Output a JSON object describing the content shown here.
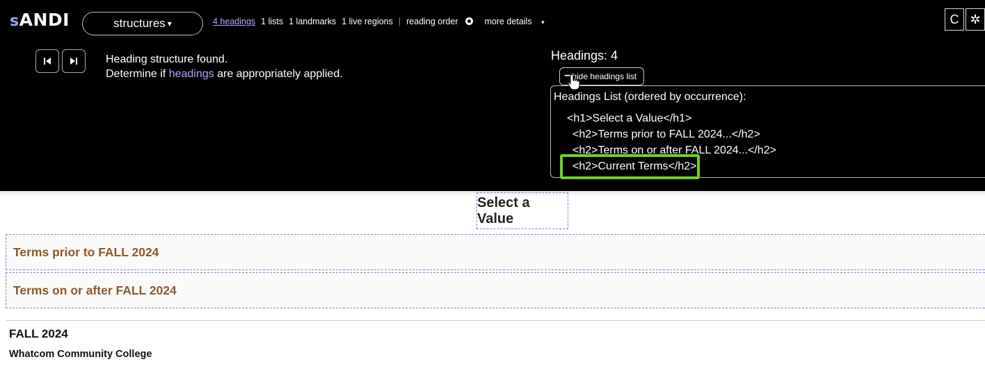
{
  "andi": {
    "logo_prefix": "s",
    "logo_main": "ANDI",
    "module": "structures",
    "caret": "▾",
    "summary": {
      "headings": "4 headings",
      "lists": "1 lists",
      "landmarks": "1 landmarks",
      "live_regions": "1 live regions",
      "separator": "|",
      "reading_order": "reading order",
      "more_details": "more details"
    },
    "refresh_icon": "C",
    "settings_icon": "✲",
    "output_line1": "Heading structure found.",
    "output_line2_pre": "Determine if ",
    "output_line2_link": "headings",
    "output_line2_post": " are appropriately applied.",
    "headings_count": "Headings: 4",
    "hide_list_label": "hide headings list",
    "hide_list_symbol": "−",
    "panel_title": "Headings List (ordered by occurrence):",
    "headings_list": [
      "<h1>Select a Value</h1>",
      "<h2>Terms prior to FALL 2024...</h2>",
      "<h2>Terms on or after FALL 2024...</h2>",
      "<h2>Current Terms</h2>"
    ],
    "highlight_color": "#6fcf2c",
    "link_color": "#b8a4ff"
  },
  "page": {
    "title": "Select a Value",
    "sections": [
      "Terms prior to FALL 2024",
      "Terms on or after FALL 2024"
    ],
    "term": "FALL 2024",
    "college": "Whatcom Community College",
    "section_color": "#8b5a2b"
  }
}
